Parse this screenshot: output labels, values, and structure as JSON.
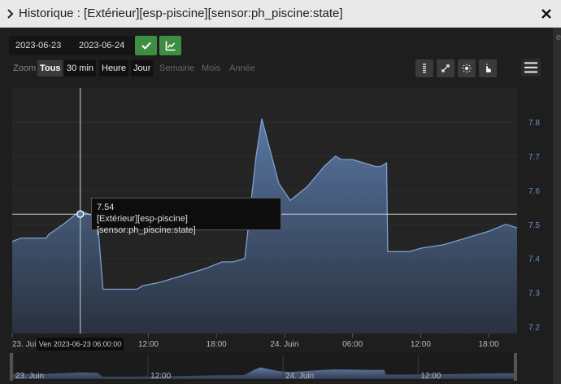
{
  "window": {
    "title": "Historique : [Extérieur][esp-piscine][sensor:ph_piscine:state]"
  },
  "dates": {
    "start": "2023-06-23",
    "end": "2023-06-24"
  },
  "range": {
    "zoom_label": "Zoom",
    "buttons": [
      "Tous",
      "30 min",
      "Heure",
      "Jour",
      "Semaine",
      "Mois",
      "Année"
    ]
  },
  "tooltip": {
    "value": "7.54",
    "series": "[Extérieur][esp-piscine][sensor:ph_piscine:state]",
    "x_label": "Ven 2023-06-23 06:00:00"
  },
  "edge_char": "e",
  "chart_data": {
    "type": "area",
    "series_name": "[Extérieur][esp-piscine][sensor:ph_piscine:state]",
    "x_unit": "hours since 2023-06-23 00:00",
    "x_tick_labels": [
      "23. Jui",
      "12:00",
      "18:00",
      "24. Juin",
      "06:00",
      "12:00",
      "18:00"
    ],
    "x_tick_hours": [
      0,
      12,
      18,
      24,
      30,
      36,
      42
    ],
    "y_ticks": [
      7.2,
      7.3,
      7.4,
      7.5,
      7.6,
      7.7,
      7.8
    ],
    "ylim": [
      7.18,
      7.9
    ],
    "xlim": [
      0,
      44.5
    ],
    "color": "#6e8fbf",
    "points": [
      [
        0,
        7.45
      ],
      [
        0.8,
        7.46
      ],
      [
        3.0,
        7.46
      ],
      [
        3.2,
        7.47
      ],
      [
        4.5,
        7.5
      ],
      [
        6.0,
        7.54
      ],
      [
        7.5,
        7.52
      ],
      [
        8.0,
        7.31
      ],
      [
        8.5,
        7.31
      ],
      [
        10.0,
        7.31
      ],
      [
        11.0,
        7.31
      ],
      [
        11.5,
        7.32
      ],
      [
        13.0,
        7.33
      ],
      [
        15.0,
        7.35
      ],
      [
        17.0,
        7.37
      ],
      [
        18.5,
        7.39
      ],
      [
        19.5,
        7.39
      ],
      [
        20.5,
        7.4
      ],
      [
        21.5,
        7.7
      ],
      [
        22.0,
        7.81
      ],
      [
        23.5,
        7.62
      ],
      [
        24.5,
        7.57
      ],
      [
        26.0,
        7.61
      ],
      [
        27.0,
        7.65
      ],
      [
        27.5,
        7.67
      ],
      [
        28.5,
        7.7
      ],
      [
        29.0,
        7.69
      ],
      [
        30.0,
        7.69
      ],
      [
        31.0,
        7.68
      ],
      [
        32.0,
        7.67
      ],
      [
        32.5,
        7.67
      ],
      [
        33.0,
        7.68
      ],
      [
        33.1,
        7.42
      ],
      [
        33.5,
        7.42
      ],
      [
        34.0,
        7.42
      ],
      [
        35.0,
        7.42
      ],
      [
        36.0,
        7.43
      ],
      [
        38.0,
        7.44
      ],
      [
        40.0,
        7.46
      ],
      [
        42.0,
        7.48
      ],
      [
        43.5,
        7.5
      ],
      [
        44.5,
        7.49
      ]
    ],
    "navigator_tick_labels": [
      "23. Juin",
      "12:00",
      "24. Juin",
      "12:00"
    ],
    "navigator_tick_hours": [
      0,
      12,
      24,
      36
    ],
    "crosshair_x_hour": 6,
    "crosshair_y_value": 7.53
  }
}
